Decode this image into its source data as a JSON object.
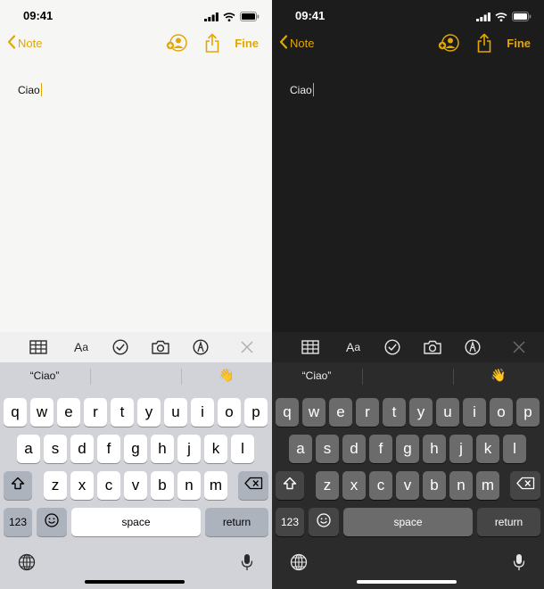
{
  "status": {
    "time": "09:41"
  },
  "nav": {
    "back_label": "Note",
    "done_label": "Fine"
  },
  "note": {
    "text": "Ciao"
  },
  "suggestions": {
    "word": "“Ciao”",
    "emoji": "👋"
  },
  "keyboard": {
    "row1": [
      "q",
      "w",
      "e",
      "r",
      "t",
      "y",
      "u",
      "i",
      "o",
      "p"
    ],
    "row2": [
      "a",
      "s",
      "d",
      "f",
      "g",
      "h",
      "j",
      "k",
      "l"
    ],
    "row3": [
      "z",
      "x",
      "c",
      "v",
      "b",
      "n",
      "m"
    ],
    "numbers_label": "123",
    "space_label": "space",
    "return_label": "return"
  },
  "colors": {
    "accent": "#e2a700",
    "light_bg": "#f6f6f4",
    "dark_bg": "#1c1c1c"
  },
  "icons": {
    "signal": "cellular-signal-icon",
    "wifi": "wifi-icon",
    "battery": "battery-icon",
    "collab": "add-person-icon",
    "share": "share-icon",
    "table": "table-icon",
    "format": "text-format-icon",
    "checklist": "checklist-icon",
    "camera": "camera-icon",
    "markup": "markup-pen-icon",
    "close": "close-icon",
    "shift": "shift-icon",
    "delete": "delete-icon",
    "emoji": "emoji-icon",
    "globe": "globe-icon",
    "mic": "microphone-icon"
  }
}
